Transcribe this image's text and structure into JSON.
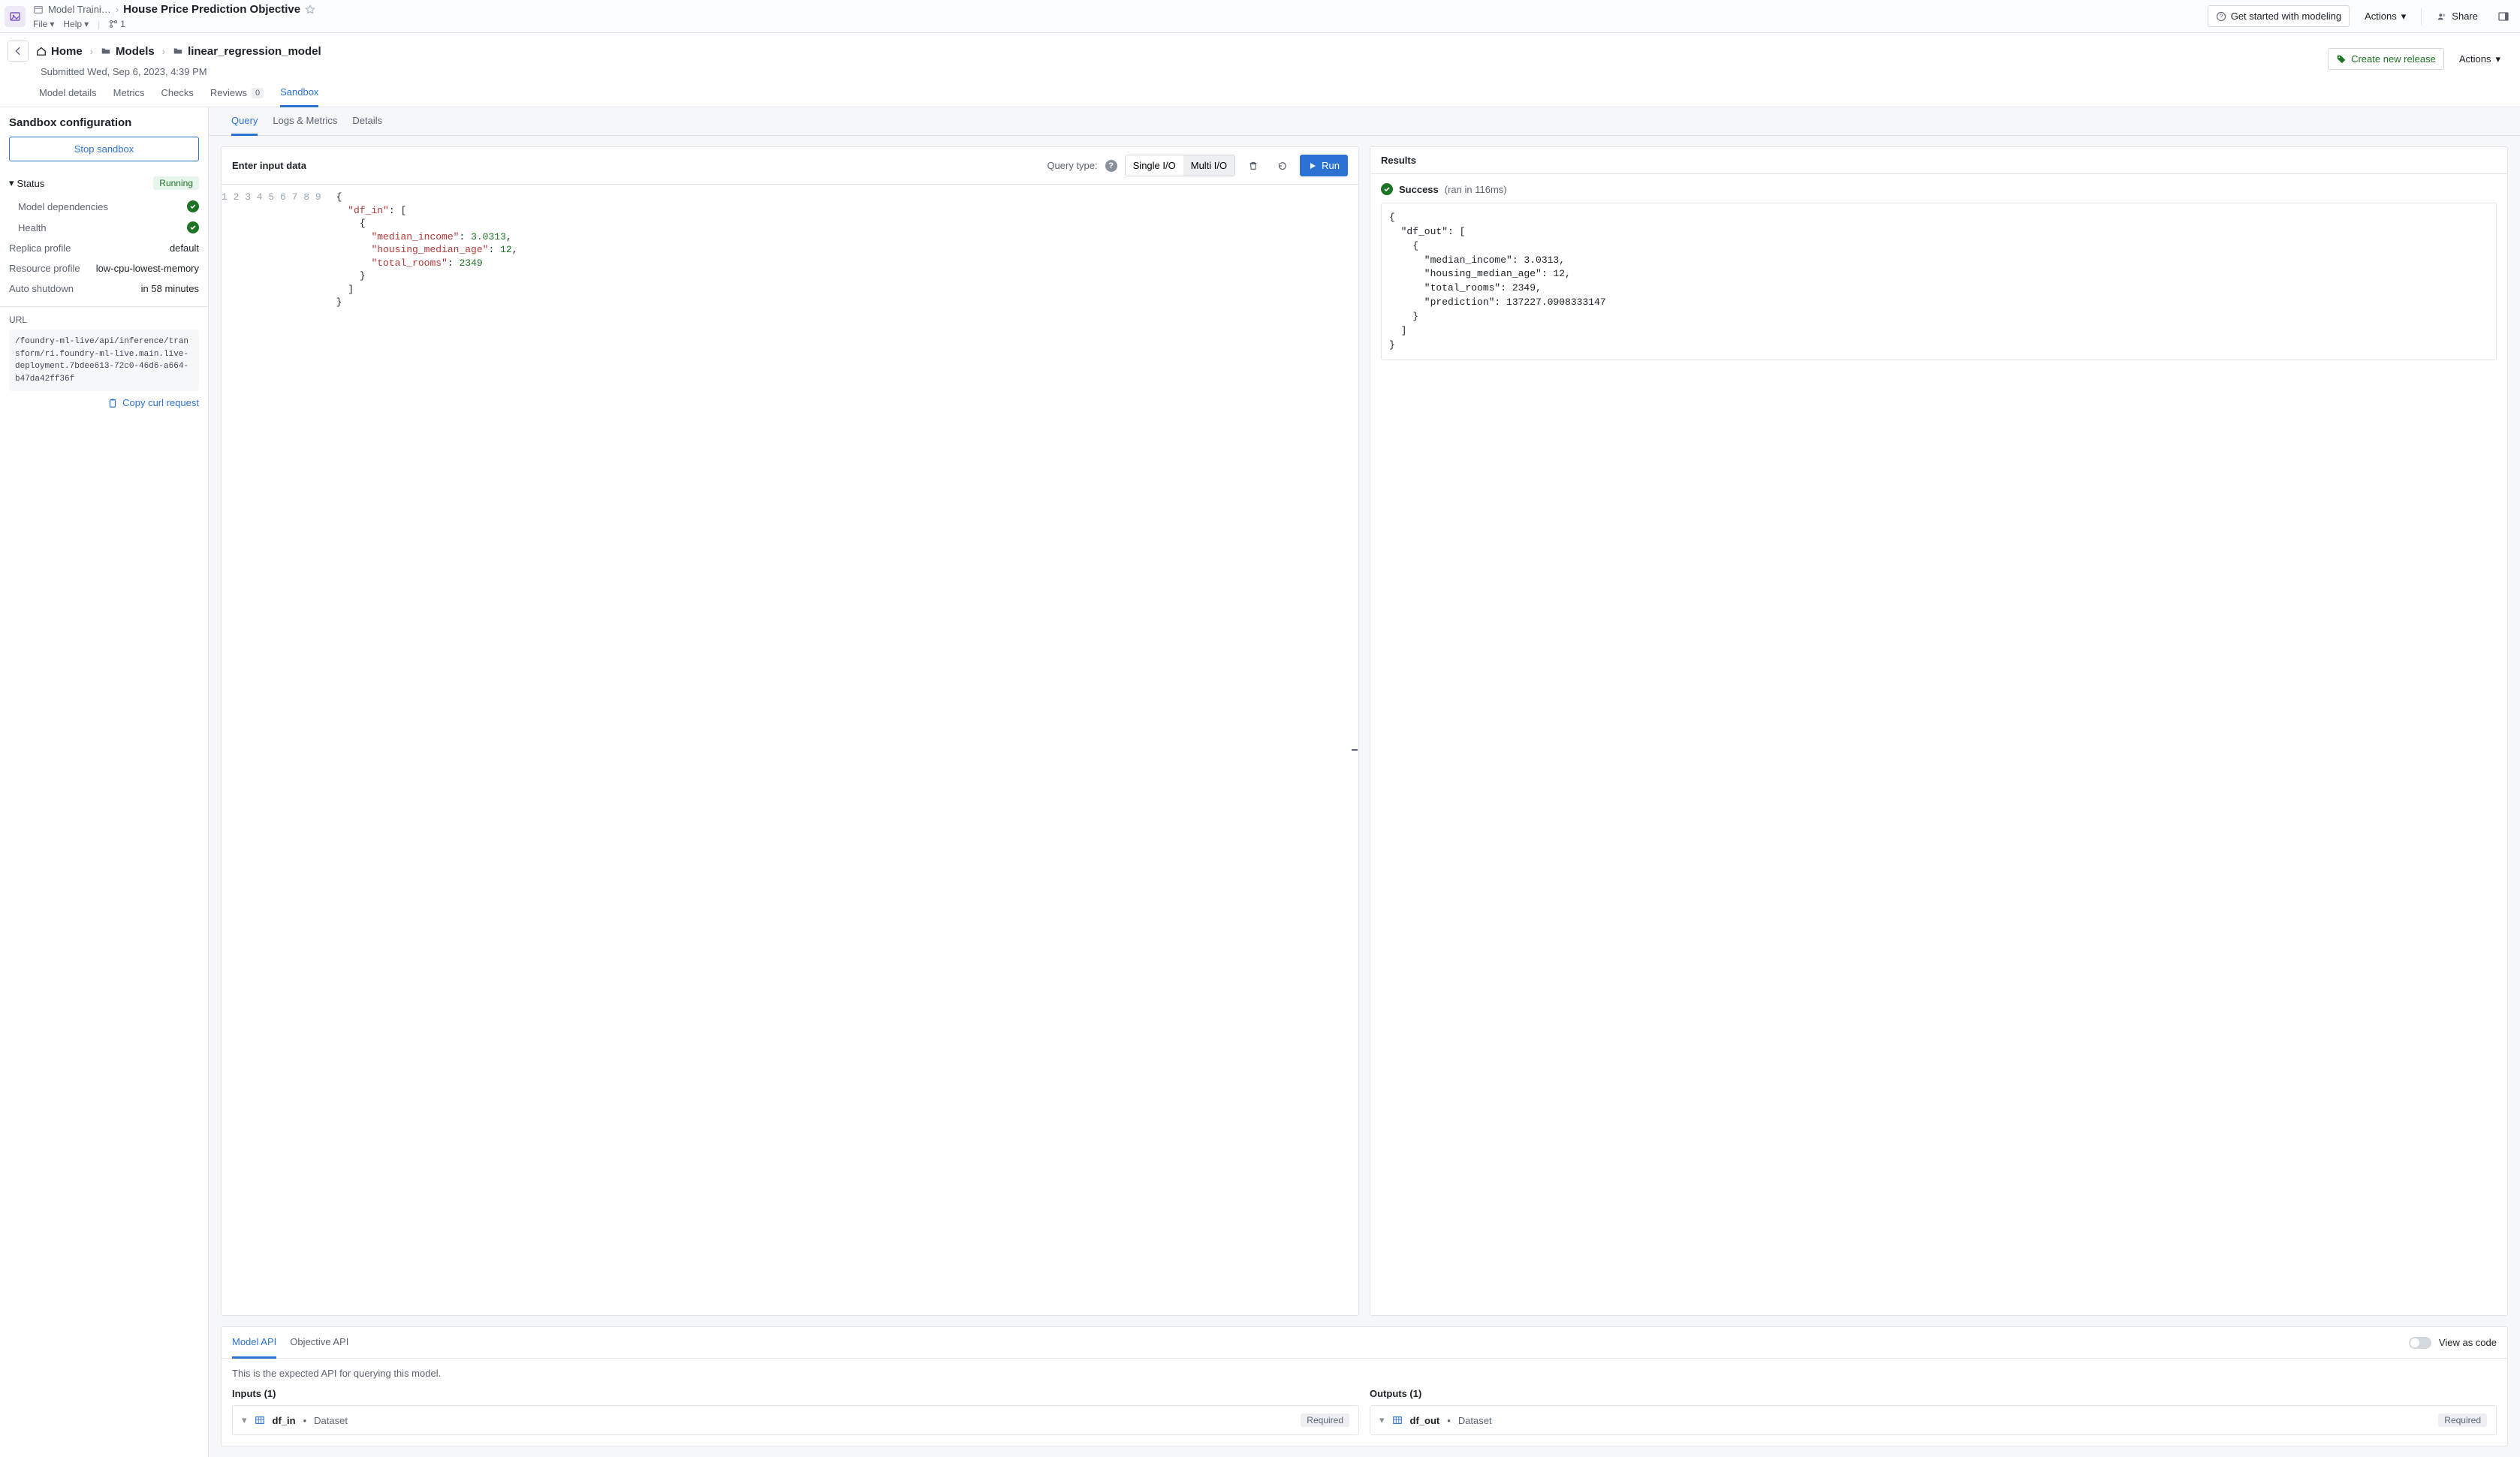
{
  "top": {
    "crumb_parent": "Model Traini…",
    "title": "House Price Prediction Objective",
    "menubar": {
      "file": "File",
      "help": "Help",
      "count": "1"
    },
    "get_started": "Get started with modeling",
    "actions": "Actions",
    "share": "Share"
  },
  "bc": {
    "home": "Home",
    "models": "Models",
    "leaf": "linear_regression_model",
    "submitted": "Submitted Wed, Sep 6, 2023, 4:39 PM",
    "create_release": "Create new release",
    "actions": "Actions"
  },
  "page_tabs": {
    "model_details": "Model details",
    "metrics": "Metrics",
    "checks": "Checks",
    "reviews": "Reviews",
    "reviews_count": "0",
    "sandbox": "Sandbox"
  },
  "sidebar": {
    "heading": "Sandbox configuration",
    "stop": "Stop sandbox",
    "status": "Status",
    "status_value": "Running",
    "model_deps": "Model dependencies",
    "health": "Health",
    "replica_profile_k": "Replica profile",
    "replica_profile_v": "default",
    "resource_profile_k": "Resource profile",
    "resource_profile_v": "low-cpu-lowest-memory",
    "auto_shutdown_k": "Auto shutdown",
    "auto_shutdown_v": "in 58 minutes",
    "url_label": "URL",
    "url_value": "/foundry-ml-live/api/inference/transform/ri.foundry-ml-live.main.live-deployment.7bdee613-72c0-46d6-a664-b47da42ff36f",
    "copy": "Copy curl request"
  },
  "content_tabs": {
    "query": "Query",
    "logs": "Logs & Metrics",
    "details": "Details"
  },
  "query": {
    "title": "Enter input data",
    "query_type_label": "Query type:",
    "single": "Single I/O",
    "multi": "Multi I/O",
    "run": "Run",
    "lines": [
      "1",
      "2",
      "3",
      "4",
      "5",
      "6",
      "7",
      "8",
      "9"
    ],
    "code_tokens": [
      [
        [
          "p",
          "{"
        ]
      ],
      [
        [
          "p",
          "  "
        ],
        [
          "k",
          "\"df_in\""
        ],
        [
          "p",
          ": ["
        ]
      ],
      [
        [
          "p",
          "    {"
        ]
      ],
      [
        [
          "p",
          "      "
        ],
        [
          "k",
          "\"median_income\""
        ],
        [
          "p",
          ": "
        ],
        [
          "n",
          "3.0313"
        ],
        [
          "p",
          ","
        ]
      ],
      [
        [
          "p",
          "      "
        ],
        [
          "k",
          "\"housing_median_age\""
        ],
        [
          "p",
          ": "
        ],
        [
          "n",
          "12"
        ],
        [
          "p",
          ","
        ]
      ],
      [
        [
          "p",
          "      "
        ],
        [
          "k",
          "\"total_rooms\""
        ],
        [
          "p",
          ": "
        ],
        [
          "n",
          "2349"
        ]
      ],
      [
        [
          "p",
          "    }"
        ]
      ],
      [
        [
          "p",
          "  ]"
        ]
      ],
      [
        [
          "p",
          "}"
        ]
      ]
    ]
  },
  "results": {
    "title": "Results",
    "status": "Success",
    "time": "(ran in 116ms)",
    "output": "{\n  \"df_out\": [\n    {\n      \"median_income\": 3.0313,\n      \"housing_median_age\": 12,\n      \"total_rooms\": 2349,\n      \"prediction\": 137227.0908333147\n    }\n  ]\n}"
  },
  "api": {
    "tab_model": "Model API",
    "tab_objective": "Objective API",
    "view_as_code": "View as code",
    "desc": "This is the expected API for querying this model.",
    "inputs_h": "Inputs (1)",
    "outputs_h": "Outputs (1)",
    "in_name": "df_in",
    "out_name": "df_out",
    "dataset": "Dataset",
    "required": "Required"
  }
}
